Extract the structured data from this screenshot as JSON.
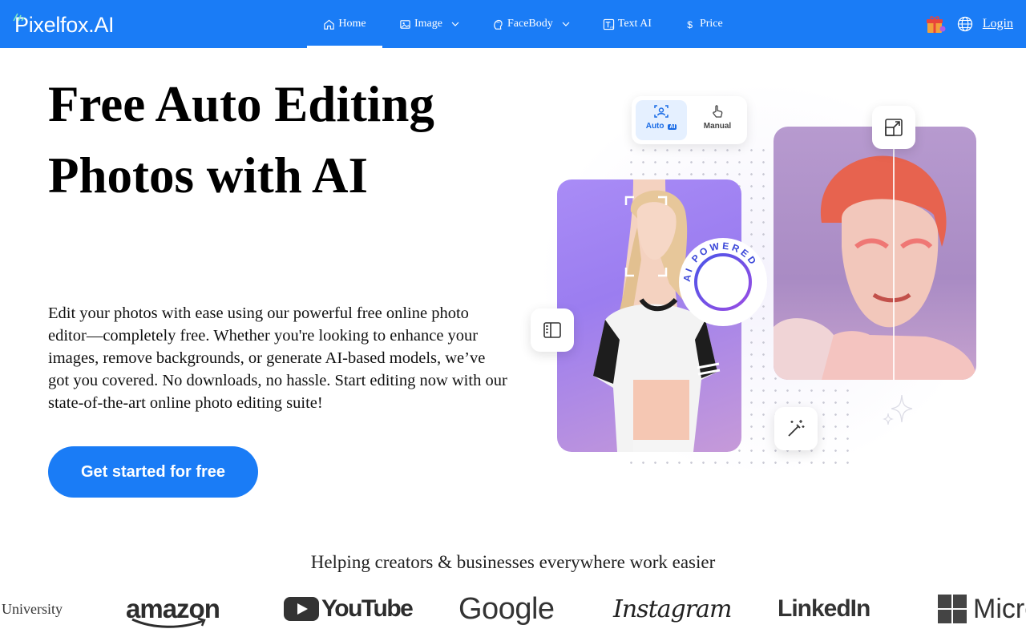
{
  "header": {
    "logo_text": "Pixelfox.AI",
    "nav": [
      {
        "label": "Home",
        "icon": "home-icon",
        "active": true,
        "dropdown": false
      },
      {
        "label": "Image",
        "icon": "image-icon",
        "active": false,
        "dropdown": true
      },
      {
        "label": "FaceBody",
        "icon": "face-body-icon",
        "active": false,
        "dropdown": true
      },
      {
        "label": "Text AI",
        "icon": "text-ai-icon",
        "active": false,
        "dropdown": false
      },
      {
        "label": "Price",
        "icon": "dollar-icon",
        "active": false,
        "dropdown": false
      }
    ],
    "login_label": "Login",
    "accent_color": "#1a7cf6"
  },
  "hero": {
    "title": "Free Auto Editing Photos with AI",
    "description": "Edit your photos with ease using our powerful free online photo editor—completely free. Whether you're looking to enhance your images, remove backgrounds, or generate AI-based models, we’ve got you covered. No downloads, no hassle. Start editing now with our state-of-the-art online photo editing suite!",
    "cta_label": "Get started for free"
  },
  "illustration": {
    "mode_auto_label": "Auto",
    "mode_auto_badge": "AI",
    "mode_manual_label": "Manual",
    "badge_text": "AI POWERED"
  },
  "partners": {
    "title": "Helping creators & businesses everywhere work easier",
    "brands": [
      "University",
      "amazon",
      "YouTube",
      "Google",
      "Instagram",
      "LinkedIn",
      "Micro"
    ]
  }
}
